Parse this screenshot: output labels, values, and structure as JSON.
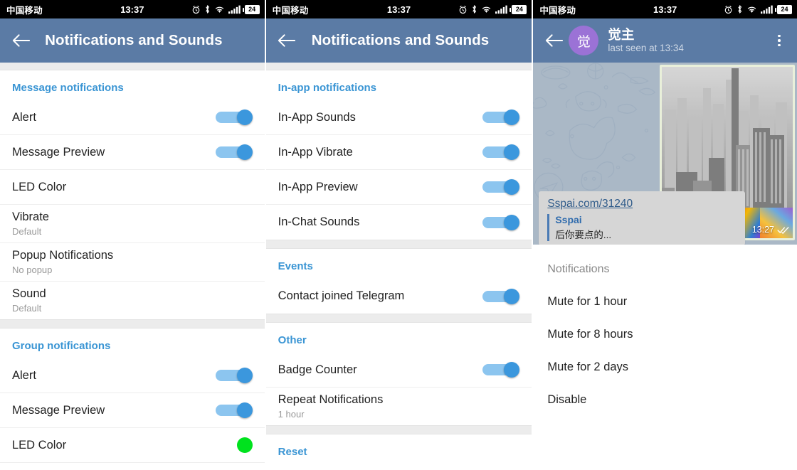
{
  "statusbar": {
    "carrier": "中国移动",
    "time": "13:37",
    "battery": "24",
    "icons": [
      "alarm-icon",
      "bluetooth-icon",
      "wifi-icon",
      "signal-icon",
      "battery-icon"
    ]
  },
  "colors": {
    "appbar": "#5b7ba5",
    "accent_blue": "#3a95d4",
    "toggle_track": "#8cc5ef",
    "toggle_thumb": "#3b97dd",
    "led_green": "#00e21e",
    "avatar_purple": "#9b72d6",
    "status_bar": "#000000"
  },
  "screen1": {
    "appbar": {
      "title": "Notifications and Sounds",
      "back_icon": "back-arrow-icon"
    },
    "sections": [
      {
        "header": "Message notifications",
        "rows": [
          {
            "label": "Alert",
            "sub": null,
            "control": "toggle",
            "on": true
          },
          {
            "label": "Message Preview",
            "sub": null,
            "control": "toggle",
            "on": true
          },
          {
            "label": "LED Color",
            "sub": null,
            "control": "none"
          },
          {
            "label": "Vibrate",
            "sub": "Default",
            "control": "none"
          },
          {
            "label": "Popup Notifications",
            "sub": "No popup",
            "control": "none"
          },
          {
            "label": "Sound",
            "sub": "Default",
            "control": "none"
          }
        ]
      },
      {
        "header": "Group notifications",
        "rows": [
          {
            "label": "Alert",
            "sub": null,
            "control": "toggle",
            "on": true
          },
          {
            "label": "Message Preview",
            "sub": null,
            "control": "toggle",
            "on": true
          },
          {
            "label": "LED Color",
            "sub": null,
            "control": "led"
          }
        ]
      }
    ]
  },
  "screen2": {
    "appbar": {
      "title": "Notifications and Sounds",
      "back_icon": "back-arrow-icon"
    },
    "sections": [
      {
        "header": "In-app notifications",
        "rows": [
          {
            "label": "In-App Sounds",
            "sub": null,
            "control": "toggle",
            "on": true
          },
          {
            "label": "In-App Vibrate",
            "sub": null,
            "control": "toggle",
            "on": true
          },
          {
            "label": "In-App Preview",
            "sub": null,
            "control": "toggle",
            "on": true
          },
          {
            "label": "In-Chat Sounds",
            "sub": null,
            "control": "toggle",
            "on": true
          }
        ]
      },
      {
        "header": "Events",
        "rows": [
          {
            "label": "Contact joined Telegram",
            "sub": null,
            "control": "toggle",
            "on": true
          }
        ]
      },
      {
        "header": "Other",
        "rows": [
          {
            "label": "Badge Counter",
            "sub": null,
            "control": "toggle",
            "on": true
          },
          {
            "label": "Repeat Notifications",
            "sub": "1 hour",
            "control": "none"
          }
        ]
      },
      {
        "header": "Reset",
        "rows": []
      }
    ]
  },
  "screen3": {
    "appbar": {
      "back_icon": "back-arrow-icon",
      "avatar_initial": "觉",
      "name": "觉主",
      "status": "last seen at 13:34",
      "menu_icon": "kebab-menu-icon"
    },
    "chat": {
      "photo_time": "13:27",
      "read_icon": "double-check-icon",
      "link_url": "Sspai.com/31240",
      "link_site": "Sspai",
      "link_desc": "后你要点的..."
    },
    "dialog": {
      "title": "Notifications",
      "options": [
        "Mute for 1 hour",
        "Mute for 8 hours",
        "Mute for 2 days",
        "Disable"
      ]
    }
  }
}
